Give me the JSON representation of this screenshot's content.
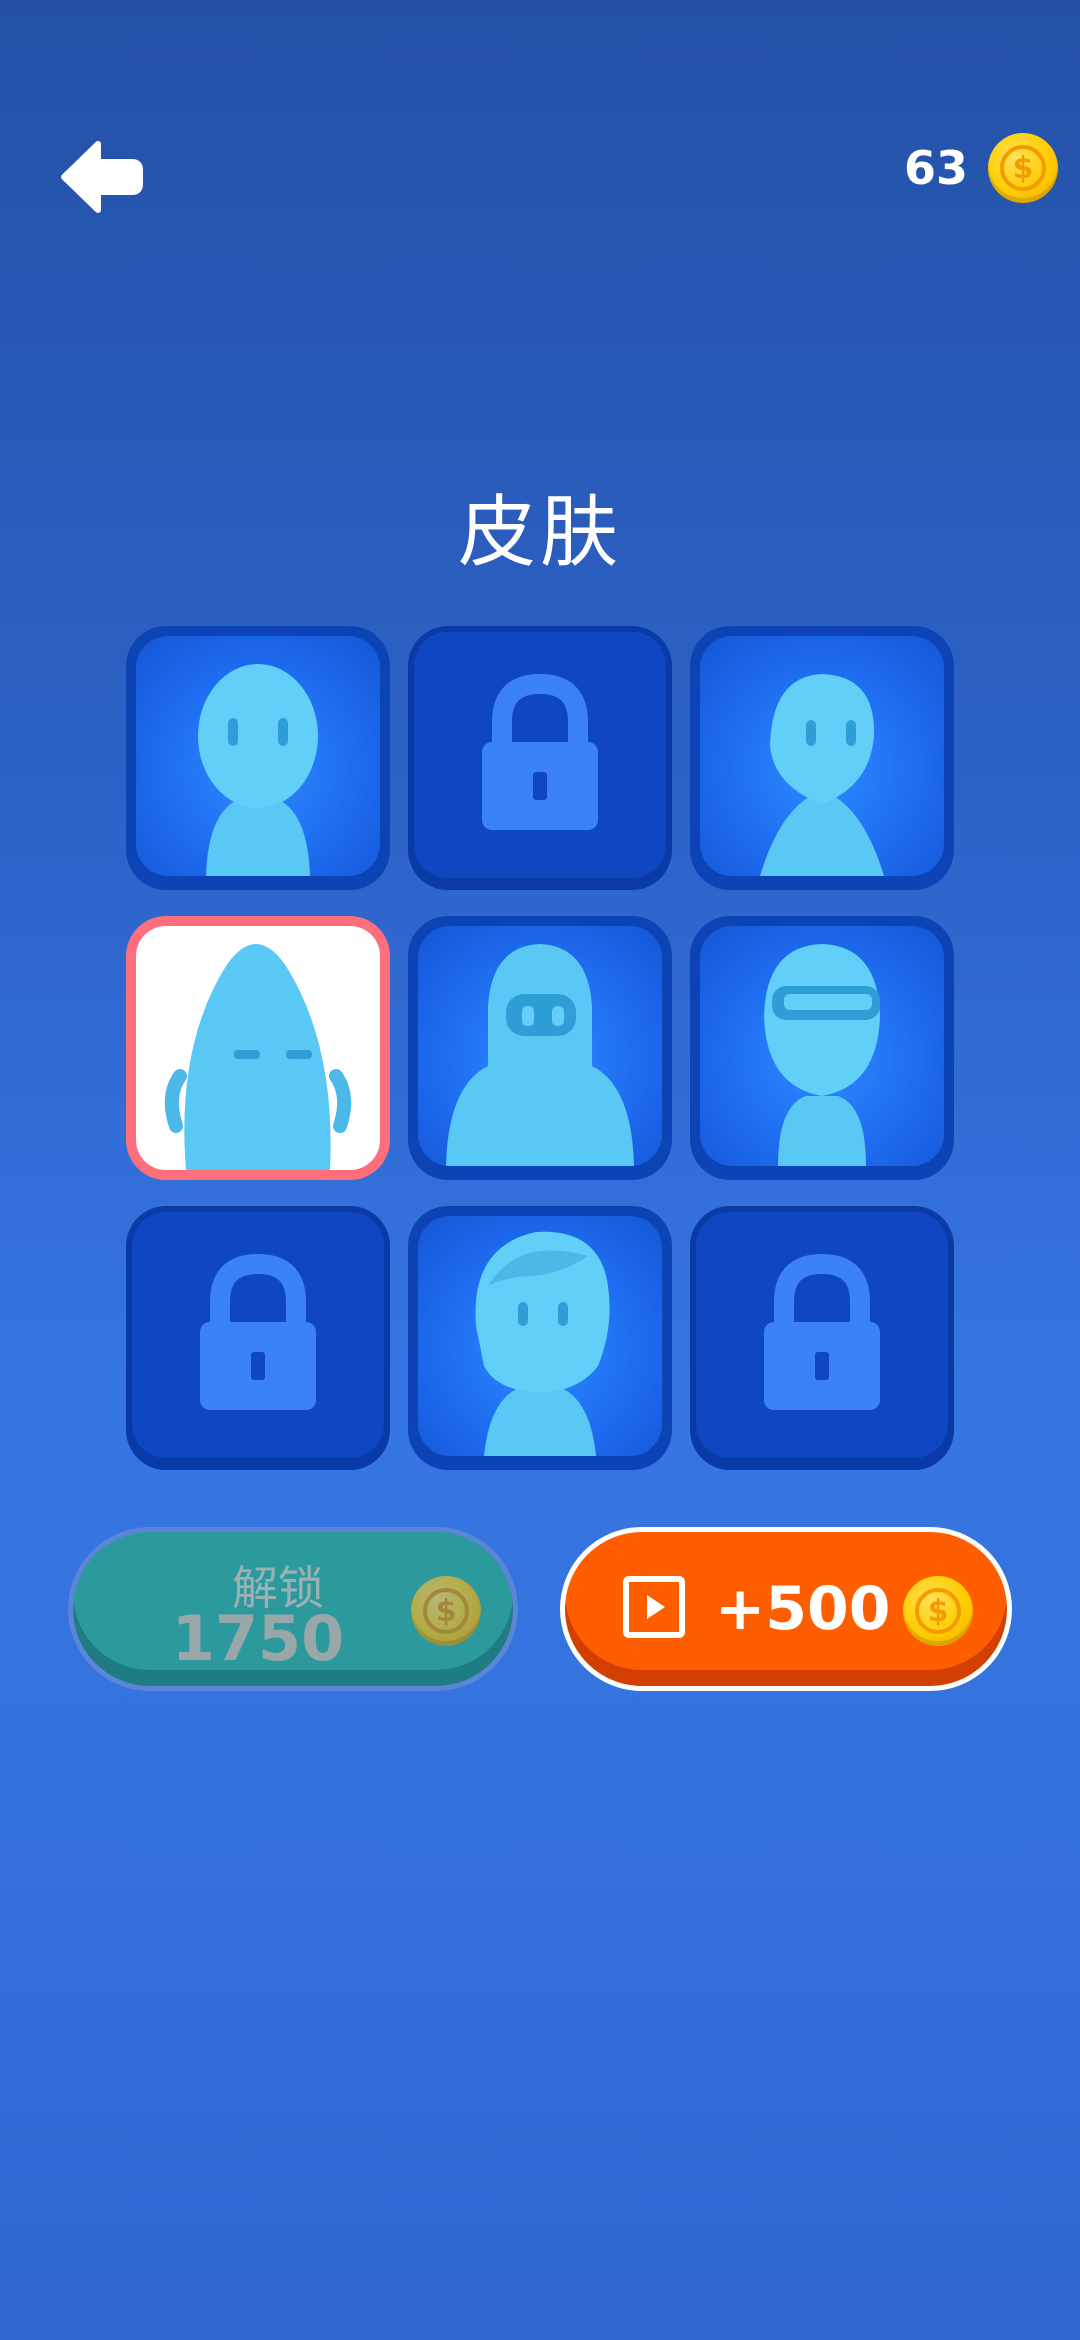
{
  "header": {
    "back_icon": "arrow-left-icon",
    "coin_count": "63",
    "coin_icon": "dollar-coin-icon"
  },
  "title": "皮肤",
  "skins": [
    {
      "state": "unlocked",
      "character": "round-head"
    },
    {
      "state": "locked"
    },
    {
      "state": "unlocked",
      "character": "pointy-head"
    },
    {
      "state": "selected",
      "character": "tall-blob"
    },
    {
      "state": "unlocked",
      "character": "hooded-visor"
    },
    {
      "state": "unlocked",
      "character": "helmet-visor"
    },
    {
      "state": "locked"
    },
    {
      "state": "unlocked",
      "character": "hair"
    },
    {
      "state": "locked"
    }
  ],
  "unlock_button": {
    "label": "解锁",
    "price": "1750",
    "icon": "dollar-coin-icon"
  },
  "reward_button": {
    "label": "+500",
    "video_icon": "play-video-icon",
    "coin_icon": "dollar-coin-icon"
  },
  "colors": {
    "background": "#2d63c9",
    "tile": "#1e6cf0",
    "locked_tile": "#0f47c2",
    "lock_icon": "#3b82f6",
    "selected_border": "#ff6f7b",
    "unlock_button": "#2c9a9c",
    "reward_button": "#ff5e00",
    "coin": "#ffcc00"
  }
}
